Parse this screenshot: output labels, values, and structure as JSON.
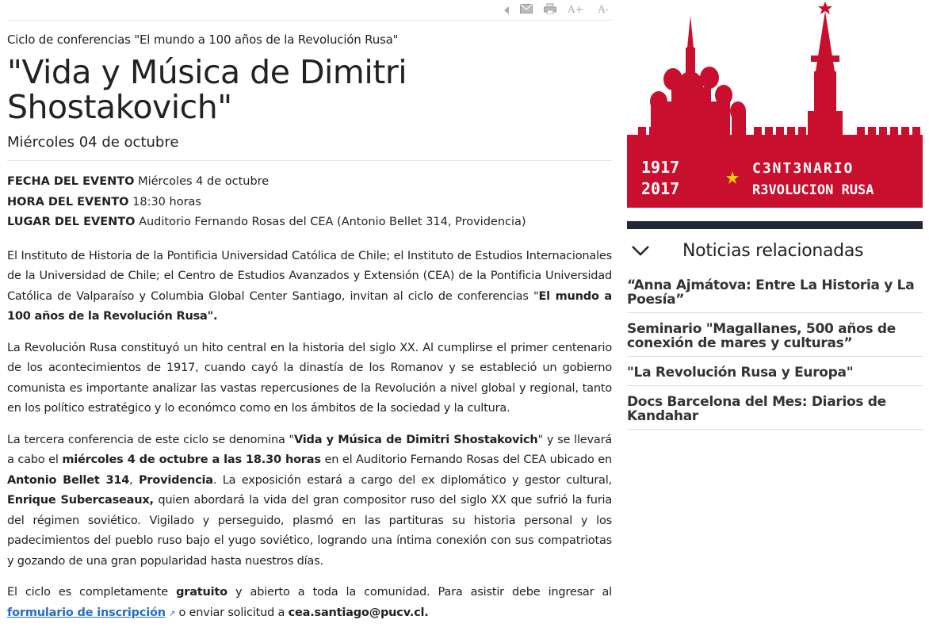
{
  "toolbar": {
    "back_icon": "back-arrow-icon",
    "email_icon": "email-icon",
    "print_icon": "print-icon",
    "font_increase": "A+",
    "font_decrease": "A-"
  },
  "article": {
    "kicker": "Ciclo de conferencias \"El mundo a 100 años de la Revolución Rusa\"",
    "title": "\"Vida y Música de Dimitri Shostakovich\"",
    "date": "Miércoles 04 de octubre",
    "meta": [
      {
        "label": "FECHA DEL EVENTO",
        "value": "Miércoles 4 de octubre"
      },
      {
        "label": "HORA DEL EVENTO",
        "value": "18:30 horas"
      },
      {
        "label": "LUGAR DEL EVENTO",
        "value": "Auditorio Fernando Rosas del CEA (Antonio Bellet 314, Providencia)"
      }
    ],
    "p1": {
      "text": "El Instituto de Historia de la Pontificia Universidad Católica de Chile; el Instituto de Estudios Internacionales de la Universidad de Chile; el Centro de Estudios Avanzados y Extensión (CEA) de la Pontificia Universidad Católica de Valparaíso y Columbia Global Center Santiago, invitan al ciclo de conferencias \"",
      "bold": "El mundo a 100 años de la Revolución Rusa\"."
    },
    "p2": "La Revolución Rusa constituyó un hito central en la historia del siglo XX. Al cumplirse el primer centenario de los acontecimientos de 1917, cuando cayó la dinastía de los Romanov y se estableció un gobierno comunista es importante analizar las vastas repercusiones de la Revolución a nivel global y regional, tanto en los político estratégico y lo económco como en los ámbitos de la sociedad y la  cultura.",
    "p3": {
      "t1": "La tercera conferencia de este ciclo se denomina \"",
      "b1": "Vida y Música de Dimitri Shostakovich",
      "t2": "\" y se llevará a cabo el ",
      "b2": "miércoles 4 de octubre a las 18.30 horas",
      "t3": " en el Auditorio Fernando Rosas del CEA ubicado en ",
      "b3": "Antonio Bellet 314",
      "t4": ", ",
      "b4": "Providencia",
      "t5": ". La exposición estará a cargo del ex diplomático y gestor cultural, ",
      "b5": "Enrique Subercaseaux,",
      "t6": " quien abordará la vida del gran compositor ruso del siglo XX que sufrió la furia del régimen soviético. Vigilado y perseguido, plasmó en las partituras su historia personal y los padecimientos del pueblo ruso bajo el yugo soviético, logrando una íntima conexión con sus compatriotas y gozando de una gran popularidad hasta nuestros días."
    },
    "p4": {
      "t1": "El ciclo es completamente ",
      "b1": "gratuito",
      "t2": " y abierto a toda la comunidad. Para asistir debe ingresar al  ",
      "link": "formulario de inscripción",
      "t3": "  o enviar solicitud a ",
      "b2": "cea.santiago@pucv.cl."
    }
  },
  "banner": {
    "year_top": "1917",
    "year_bottom": "2017",
    "line1": "C3NT3NARIO",
    "line2": "R3VOLUCION RUSA",
    "colors": {
      "red": "#c8102e",
      "star": "#f5d000"
    }
  },
  "sidebar": {
    "related_title": "Noticias relacionadas",
    "items": [
      "“Anna Ajmátova: Entre La Historia y La Poesía”",
      "Seminario \"Magallanes, 500 años de conexión de mares y culturas”",
      "\"La Revolución Rusa y Europa\"",
      "Docs Barcelona del Mes: Diarios de Kandahar"
    ]
  }
}
